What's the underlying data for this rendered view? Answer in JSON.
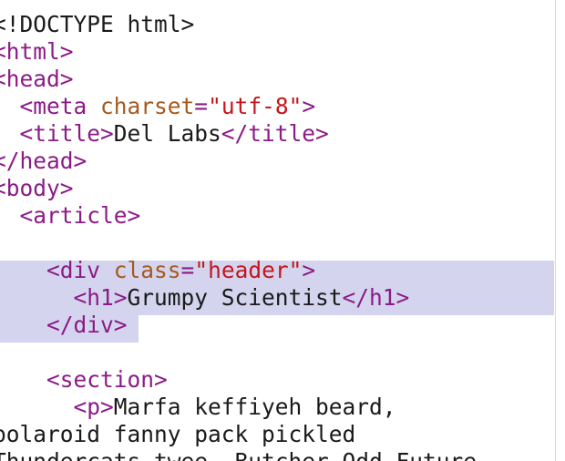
{
  "editor": {
    "lines": [
      {
        "indent": "",
        "parts": [
          {
            "c": "t",
            "v": "<!DOCTYPE html>"
          }
        ]
      },
      {
        "indent": "",
        "parts": [
          {
            "c": "p",
            "v": "<html>"
          }
        ]
      },
      {
        "indent": "",
        "parts": [
          {
            "c": "p",
            "v": "<head>"
          }
        ]
      },
      {
        "indent": "  ",
        "parts": [
          {
            "c": "p",
            "v": "<meta "
          },
          {
            "c": "a",
            "v": "charset"
          },
          {
            "c": "p",
            "v": "="
          },
          {
            "c": "s",
            "v": "\"utf-8\""
          },
          {
            "c": "p",
            "v": ">"
          }
        ]
      },
      {
        "indent": "  ",
        "parts": [
          {
            "c": "p",
            "v": "<title>"
          },
          {
            "c": "t",
            "v": "Del Labs"
          },
          {
            "c": "p",
            "v": "</title>"
          }
        ]
      },
      {
        "indent": "",
        "parts": [
          {
            "c": "p",
            "v": "</head>"
          }
        ]
      },
      {
        "indent": "",
        "parts": [
          {
            "c": "p",
            "v": "<body>"
          }
        ]
      },
      {
        "indent": "  ",
        "parts": [
          {
            "c": "p",
            "v": "<article>"
          }
        ]
      },
      {
        "indent": "",
        "parts": []
      },
      {
        "indent": "    ",
        "parts": [
          {
            "c": "p",
            "v": "<div "
          },
          {
            "c": "a",
            "v": "class"
          },
          {
            "c": "p",
            "v": "="
          },
          {
            "c": "s",
            "v": "\"header\""
          },
          {
            "c": "p",
            "v": ">"
          }
        ]
      },
      {
        "indent": "      ",
        "parts": [
          {
            "c": "p",
            "v": "<h1>"
          },
          {
            "c": "t",
            "v": "Grumpy Scientist"
          },
          {
            "c": "p",
            "v": "</h1>"
          }
        ]
      },
      {
        "indent": "    ",
        "parts": [
          {
            "c": "p",
            "v": "</div>"
          }
        ]
      },
      {
        "indent": "",
        "parts": []
      },
      {
        "indent": "    ",
        "parts": [
          {
            "c": "p",
            "v": "<section>"
          }
        ]
      },
      {
        "indent": "      ",
        "parts": [
          {
            "c": "p",
            "v": "<p>"
          },
          {
            "c": "t",
            "v": "Marfa keffiyeh beard,"
          }
        ]
      },
      {
        "indent": "",
        "parts": [
          {
            "c": "t",
            "v": "polaroid fanny pack pickled"
          }
        ]
      },
      {
        "indent": "",
        "parts": [
          {
            "c": "t",
            "v": "Thundercats twee, Butcher Odd Future"
          }
        ]
      }
    ]
  }
}
